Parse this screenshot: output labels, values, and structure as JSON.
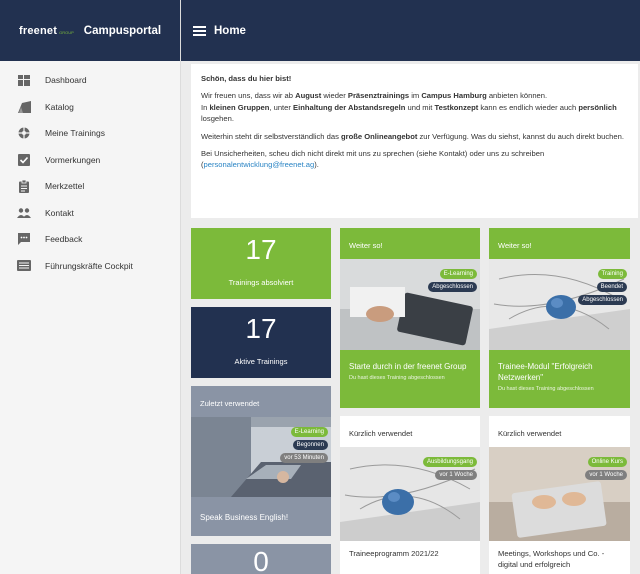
{
  "brand": {
    "logo": "freenet",
    "logo_sub": "GROUP",
    "portal": "Campusportal"
  },
  "topbar": {
    "title": "Home"
  },
  "sidebar": {
    "items": [
      {
        "label": "Dashboard",
        "icon": "dashboard-icon"
      },
      {
        "label": "Katalog",
        "icon": "catalog-icon"
      },
      {
        "label": "Meine Trainings",
        "icon": "trainings-icon"
      },
      {
        "label": "Vormerkungen",
        "icon": "checkbox-icon"
      },
      {
        "label": "Merkzettel",
        "icon": "clipboard-icon"
      },
      {
        "label": "Kontakt",
        "icon": "people-icon"
      },
      {
        "label": "Feedback",
        "icon": "feedback-icon"
      },
      {
        "label": "Führungskräfte Cockpit",
        "icon": "cockpit-icon"
      }
    ]
  },
  "welcome": {
    "heading": "Schön, dass du hier bist!",
    "p1_a": "Wir freuen uns, dass wir ab ",
    "p1_b": "August",
    "p1_c": " wieder ",
    "p1_d": "Präsenztrainings",
    "p1_e": " im ",
    "p1_f": "Campus Hamburg",
    "p1_g": " anbieten können.",
    "p1_h": "In ",
    "p1_i": "kleinen Gruppen",
    "p1_j": ", unter ",
    "p1_k": "Einhaltung der Abstandsregeln",
    "p1_l": " und mit ",
    "p1_m": "Testkonzept",
    "p1_n": " kann es endlich wieder auch ",
    "p1_o": "persönlich",
    "p1_p": " losgehen.",
    "p2_a": "Weiterhin steht dir selbstverständlich das ",
    "p2_b": "große Onlineangebot",
    "p2_c": " zur Verfügung. Was du siehst, kannst du auch direkt buchen.",
    "p3_a": "Bei Unsicherheiten, scheu dich nicht direkt mit uns zu sprechen (siehe Kontakt) oder uns zu schreiben (",
    "p3_link": "personalentwicklung@freenet.ag",
    "p3_b": ")."
  },
  "stats": {
    "completed": {
      "value": "17",
      "label": "Trainings absolviert"
    },
    "active": {
      "value": "17",
      "label": "Aktive Trainings"
    },
    "third": {
      "value": "0"
    }
  },
  "recent_left": {
    "head": "Zuletzt verwendet",
    "badges": [
      "E-Learning",
      "Begonnen",
      "vor 53 Minuten"
    ],
    "title": "Speak Business English!"
  },
  "next1": {
    "head": "Weiter so!",
    "badges": [
      "E-Learning",
      "Abgeschlossen"
    ],
    "title": "Starte durch in der freenet Group",
    "sub": "Du hast dieses Training abgeschlossen"
  },
  "next2": {
    "head": "Weiter so!",
    "badges": [
      "Training",
      "Beendet",
      "Abgeschlossen"
    ],
    "title": "Trainee-Modul \"Erfolgreich Netzwerken\"",
    "sub": "Du hast dieses Training abgeschlossen"
  },
  "recent1": {
    "head": "Kürzlich verwendet",
    "badges": [
      "Ausbildungsgang",
      "vor 1 Woche"
    ],
    "title": "Traineeprogramm 2021/22"
  },
  "recent2": {
    "head": "Kürzlich verwendet",
    "badges": [
      "Online Kurs",
      "vor 1 Woche"
    ],
    "title": "Meetings, Workshops und Co. - digital und erfolgreich"
  },
  "colors": {
    "navy": "#223150",
    "green": "#7cba3a",
    "gray": "#8a94a5",
    "link": "#2a84c4"
  }
}
